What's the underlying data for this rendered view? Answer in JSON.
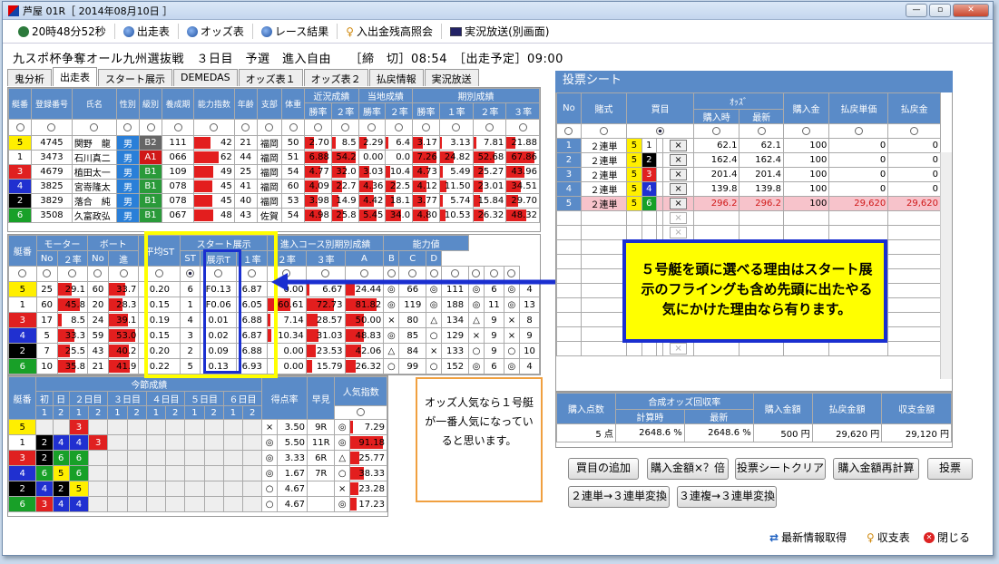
{
  "window": {
    "title": "芦屋 01R［ 2014年08月10日 ］"
  },
  "toolbar": {
    "clock": "20時48分52秒",
    "btn_entries": "出走表",
    "btn_odds": "オッズ表",
    "btn_results": "レース結果",
    "btn_balance": "入出金残高照会",
    "btn_live": "実況放送(別画面)"
  },
  "race_info": "九スポ杯争奪オール九州選抜戦　３日目　予選　進入自由　　［締　切］08:54　［出走予定］09:00",
  "tabs": [
    "鬼分析",
    "出走表",
    "スタート展示",
    "DEMEDAS",
    "オッズ表１",
    "オッズ表２",
    "払戻情報",
    "実況放送"
  ],
  "entries": {
    "headers": [
      "艇番",
      "登録番号",
      "氏名",
      "性別",
      "級別",
      "養成期",
      "能力指数",
      "年齢",
      "支部",
      "体重",
      "近況成績",
      "当地成績",
      "期別成績"
    ],
    "subheaders": [
      "勝率",
      "２率",
      "勝率",
      "２率",
      "勝率",
      "１率",
      "２率",
      "３率"
    ],
    "rows": [
      {
        "lane": "5",
        "reg": "4745",
        "name": "関野　龍",
        "sex": "男",
        "cls": "B2",
        "ki": "111",
        "ab": "42",
        "age": "21",
        "br": "福岡",
        "wt": "50",
        "v": [
          "2.70",
          "8.5",
          "2.29",
          "6.4",
          "3.17",
          "3.13",
          "7.81",
          "21.88"
        ]
      },
      {
        "lane": "1",
        "reg": "3473",
        "name": "石川真二",
        "sex": "男",
        "cls": "A1",
        "ki": "066",
        "ab": "62",
        "age": "44",
        "br": "福岡",
        "wt": "51",
        "v": [
          "6.88",
          "54.2",
          "0.00",
          "0.0",
          "7.26",
          "24.82",
          "52.68",
          "67.86"
        ]
      },
      {
        "lane": "3",
        "reg": "4679",
        "name": "植田太一",
        "sex": "男",
        "cls": "B1",
        "ki": "109",
        "ab": "49",
        "age": "25",
        "br": "福岡",
        "wt": "54",
        "v": [
          "4.77",
          "32.0",
          "3.03",
          "10.4",
          "4.73",
          "5.49",
          "25.27",
          "43.96"
        ]
      },
      {
        "lane": "4",
        "reg": "3825",
        "name": "宮嵜隆太",
        "sex": "男",
        "cls": "B1",
        "ki": "078",
        "ab": "45",
        "age": "41",
        "br": "福岡",
        "wt": "60",
        "v": [
          "4.09",
          "22.7",
          "4.36",
          "22.5",
          "4.12",
          "11.50",
          "23.01",
          "34.51"
        ]
      },
      {
        "lane": "2",
        "reg": "3829",
        "name": "落合　純",
        "sex": "男",
        "cls": "B1",
        "ki": "078",
        "ab": "45",
        "age": "40",
        "br": "福岡",
        "wt": "53",
        "v": [
          "3.98",
          "14.9",
          "4.42",
          "18.1",
          "3.77",
          "5.74",
          "15.84",
          "29.70"
        ]
      },
      {
        "lane": "6",
        "reg": "3508",
        "name": "久富政弘",
        "sex": "男",
        "cls": "B1",
        "ki": "067",
        "ab": "48",
        "age": "43",
        "br": "佐賀",
        "wt": "54",
        "v": [
          "4.98",
          "25.8",
          "5.45",
          "34.0",
          "4.80",
          "10.53",
          "26.32",
          "48.32"
        ]
      }
    ]
  },
  "start": {
    "headers": [
      "艇番",
      "モーター",
      "ボート",
      "平均ST",
      "スタート展示",
      "進入コース別期別成績",
      "能力値"
    ],
    "subheaders": [
      "No",
      "２率",
      "No",
      "２率",
      "進",
      "ST",
      "展示T",
      "１率",
      "２率",
      "３率",
      "A",
      "B",
      "C",
      "D"
    ],
    "rows": [
      {
        "lane": "5",
        "mno": "25",
        "m2": "29.1",
        "bno": "60",
        "b2": "33.7",
        "ast": "0.20",
        "sin": "6",
        "st": "F0.13",
        "tenji": "6.87",
        "r1": "0.00",
        "r2": "6.67",
        "r3": "24.44",
        "A": "◎",
        "An": "66",
        "B": "◎",
        "Bn": "111",
        "C": "◎",
        "Cn": "6",
        "D": "◎",
        "Dn": "4"
      },
      {
        "lane": "1",
        "mno": "60",
        "m2": "45.8",
        "bno": "20",
        "b2": "28.3",
        "ast": "0.15",
        "sin": "1",
        "st": "F0.06",
        "tenji": "6.05",
        "r1": "60.61",
        "r2": "72.73",
        "r3": "81.82",
        "A": "◎",
        "An": "119",
        "B": "◎",
        "Bn": "188",
        "C": "◎",
        "Cn": "11",
        "D": "◎",
        "Dn": "13"
      },
      {
        "lane": "3",
        "mno": "17",
        "m2": "8.5",
        "bno": "24",
        "b2": "39.1",
        "ast": "0.19",
        "sin": "4",
        "st": "0.01",
        "tenji": "6.88",
        "r1": "7.14",
        "r2": "28.57",
        "r3": "50.00",
        "A": "×",
        "An": "80",
        "B": "△",
        "Bn": "134",
        "C": "△",
        "Cn": "9",
        "D": "×",
        "Dn": "8"
      },
      {
        "lane": "4",
        "mno": "5",
        "m2": "33.3",
        "bno": "59",
        "b2": "53.0",
        "ast": "0.15",
        "sin": "3",
        "st": "0.02",
        "tenji": "6.87",
        "r1": "10.34",
        "r2": "31.03",
        "r3": "48.83",
        "A": "◎",
        "An": "85",
        "B": "○",
        "Bn": "129",
        "C": "×",
        "Cn": "9",
        "D": "×",
        "Dn": "9"
      },
      {
        "lane": "2",
        "mno": "7",
        "m2": "25.5",
        "bno": "43",
        "b2": "40.2",
        "ast": "0.20",
        "sin": "2",
        "st": "0.09",
        "tenji": "6.88",
        "r1": "0.00",
        "r2": "23.53",
        "r3": "42.06",
        "A": "△",
        "An": "84",
        "B": "×",
        "Bn": "133",
        "C": "○",
        "Cn": "9",
        "D": "○",
        "Dn": "10"
      },
      {
        "lane": "6",
        "mno": "10",
        "m2": "35.8",
        "bno": "21",
        "b2": "41.9",
        "ast": "0.22",
        "sin": "5",
        "st": "0.13",
        "tenji": "6.93",
        "r1": "0.00",
        "r2": "15.79",
        "r3": "26.32",
        "A": "○",
        "An": "99",
        "B": "○",
        "Bn": "152",
        "C": "◎",
        "Cn": "6",
        "D": "◎",
        "Dn": "4"
      }
    ]
  },
  "session": {
    "headers": [
      "艇番",
      "今節成績",
      "得点率",
      "早見",
      "人気指数"
    ],
    "days": [
      "初",
      "日",
      "２日目",
      "３日目",
      "４日目",
      "５日目",
      "６日目"
    ],
    "nums": [
      "1",
      "2",
      "1",
      "2",
      "1",
      "2",
      "1",
      "2",
      "1",
      "2",
      "1",
      "2"
    ],
    "rows": [
      {
        "lane": "5",
        "cells": [
          "",
          "",
          "3",
          "",
          "",
          "",
          "",
          "",
          "",
          "",
          "",
          ""
        ],
        "mk": "×",
        "score": "3.50",
        "hay": "9R",
        "ms": "◎",
        "pop": "7.29"
      },
      {
        "lane": "1",
        "cells": [
          "2",
          "4",
          "4",
          "3",
          "",
          "",
          "",
          "",
          "",
          "",
          "",
          ""
        ],
        "mk": "◎",
        "score": "5.50",
        "hay": "11R",
        "ms": "◎",
        "pop": "91.18"
      },
      {
        "lane": "3",
        "cells": [
          "2",
          "6",
          "6",
          "",
          "",
          "",
          "",
          "",
          "",
          "",
          "",
          ""
        ],
        "mk": "◎",
        "score": "3.33",
        "hay": "6R",
        "ms": "△",
        "pop": "25.77"
      },
      {
        "lane": "4",
        "cells": [
          "6",
          "5",
          "6",
          "",
          "",
          "",
          "",
          "",
          "",
          "",
          "",
          ""
        ],
        "mk": "◎",
        "score": "1.67",
        "hay": "7R",
        "ms": "○",
        "pop": "38.33"
      },
      {
        "lane": "2",
        "cells": [
          "4",
          "2",
          "5",
          "",
          "",
          "",
          "",
          "",
          "",
          "",
          "",
          ""
        ],
        "mk": "○",
        "score": "4.67",
        "hay": "",
        "ms": "×",
        "pop": "23.28"
      },
      {
        "lane": "6",
        "cells": [
          "3",
          "4",
          "4",
          "",
          "",
          "",
          "",
          "",
          "",
          "",
          "",
          ""
        ],
        "mk": "○",
        "score": "4.67",
        "hay": "",
        "ms": "◎",
        "pop": "17.23"
      }
    ]
  },
  "ticket": {
    "title": "投票シート",
    "headers": [
      "No",
      "賭式",
      "買目",
      "ｵｯｽﾞ",
      "購入金",
      "払戻単価",
      "払戻金"
    ],
    "odds_sub": [
      "購入時",
      "最新"
    ],
    "rows": [
      {
        "no": "1",
        "type": "２連単",
        "a": "5",
        "b": "1",
        "x": "×",
        "o1": "62.1",
        "o2": "62.1",
        "buy": "100",
        "unit": "0",
        "pay": "0"
      },
      {
        "no": "2",
        "type": "２連単",
        "a": "5",
        "b": "2",
        "x": "×",
        "o1": "162.4",
        "o2": "162.4",
        "buy": "100",
        "unit": "0",
        "pay": "0"
      },
      {
        "no": "3",
        "type": "２連単",
        "a": "5",
        "b": "3",
        "x": "×",
        "o1": "201.4",
        "o2": "201.4",
        "buy": "100",
        "unit": "0",
        "pay": "0"
      },
      {
        "no": "4",
        "type": "２連単",
        "a": "5",
        "b": "4",
        "x": "×",
        "o1": "139.8",
        "o2": "139.8",
        "buy": "100",
        "unit": "0",
        "pay": "0"
      },
      {
        "no": "5",
        "type": "２連単",
        "a": "5",
        "b": "6",
        "x": "×",
        "o1": "296.2",
        "o2": "296.2",
        "buy": "100",
        "unit": "29,620",
        "pay": "29,620"
      }
    ],
    "summary_headers": [
      "購入点数",
      "合成オッズ回収率",
      "購入金額",
      "払戻金額",
      "収支金額"
    ],
    "summary_sub": [
      "計算時",
      "最新"
    ],
    "summary": {
      "count": "5 点",
      "calc": "2648.6 %",
      "latest": "2648.6 %",
      "buy": "500 円",
      "pay": "29,620 円",
      "bal": "29,120 円"
    }
  },
  "buttons": {
    "add": "買目の追加",
    "mult": "購入金額×？倍",
    "clear": "投票シートクリア",
    "recalc": "購入金額再計算",
    "vote": "投票",
    "conv1": "２連単→３連単変換",
    "conv2": "３連複→３連単変換"
  },
  "footer": {
    "refresh": "最新情報取得",
    "balance": "収支表",
    "close": "閉じる"
  },
  "notes": {
    "callout1": "５号艇を頭に選べる理由はスタート展示のフライングも含め先頭に出たやる気にかけた理由なら有ります。",
    "callout2": "オッズ人気なら１号艇が一番人気になっていると思います。"
  },
  "colors": {
    "header_blue": "#5a8bc8",
    "bar_red": "#e31e1e",
    "highlight_yellow": "#ffff00",
    "highlight_blue": "#1a2fd0",
    "selected_row": "#f7c3cb"
  }
}
